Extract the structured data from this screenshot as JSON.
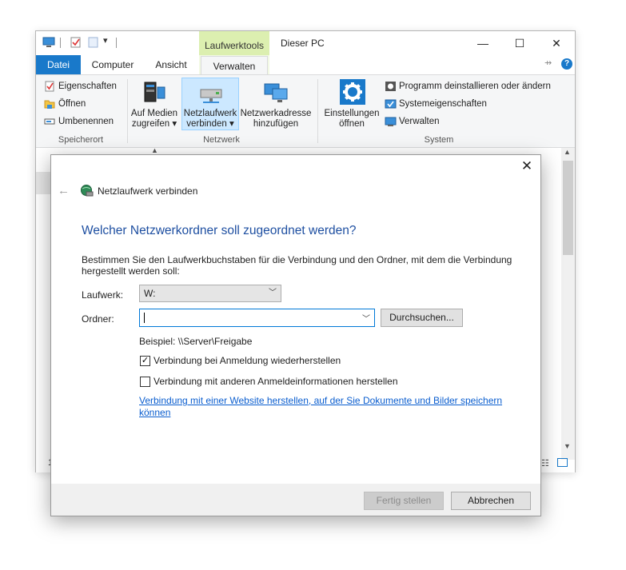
{
  "explorer": {
    "title": "Dieser PC",
    "contextual_tab": "Laufwerktools",
    "tabs": [
      "Datei",
      "Computer",
      "Ansicht",
      "Verwalten"
    ],
    "caption_buttons": {
      "minimize": "—",
      "maximize": "☐",
      "close": "✕"
    },
    "ribbon": {
      "speicherort": {
        "label": "Speicherort",
        "items": [
          "Eigenschaften",
          "Öffnen",
          "Umbenennen"
        ]
      },
      "netzwerk": {
        "label": "Netzwerk",
        "auf_medien": [
          "Auf Medien",
          "zugreifen ▾"
        ],
        "netzlaufwerk": [
          "Netzlaufwerk",
          "verbinden ▾"
        ],
        "netzwerkadresse": [
          "Netzwerkadresse",
          "hinzufügen"
        ]
      },
      "system": {
        "label": "System",
        "einstellungen": [
          "Einstellungen",
          "öffnen"
        ],
        "items": [
          "Programm deinstallieren oder ändern",
          "Systemeigenschaften",
          "Verwalten"
        ]
      }
    },
    "status_left": "1"
  },
  "dialog": {
    "title": "Netzlaufwerk verbinden",
    "heading": "Welcher Netzwerkordner soll zugeordnet werden?",
    "description": "Bestimmen Sie den Laufwerkbuchstaben für die Verbindung und den Ordner, mit dem die Verbindung hergestellt werden soll:",
    "drive_label": "Laufwerk:",
    "drive_value": "W:",
    "folder_label": "Ordner:",
    "folder_value": "",
    "browse_button": "Durchsuchen...",
    "example": "Beispiel: \\\\Server\\Freigabe",
    "reconnect_label": "Verbindung bei Anmeldung wiederherstellen",
    "reconnect_checked": true,
    "other_credentials_label": "Verbindung mit anderen Anmeldeinformationen herstellen",
    "other_credentials_checked": false,
    "website_link": "Verbindung mit einer Website herstellen, auf der Sie Dokumente und Bilder speichern können",
    "finish_button": "Fertig stellen",
    "cancel_button": "Abbrechen",
    "close_glyph": "✕",
    "back_glyph": "←"
  },
  "colors": {
    "accent": "#1979ca",
    "heading": "#1e4fa1",
    "link": "#0b5ecf",
    "context_tab": "#dcefb0"
  }
}
